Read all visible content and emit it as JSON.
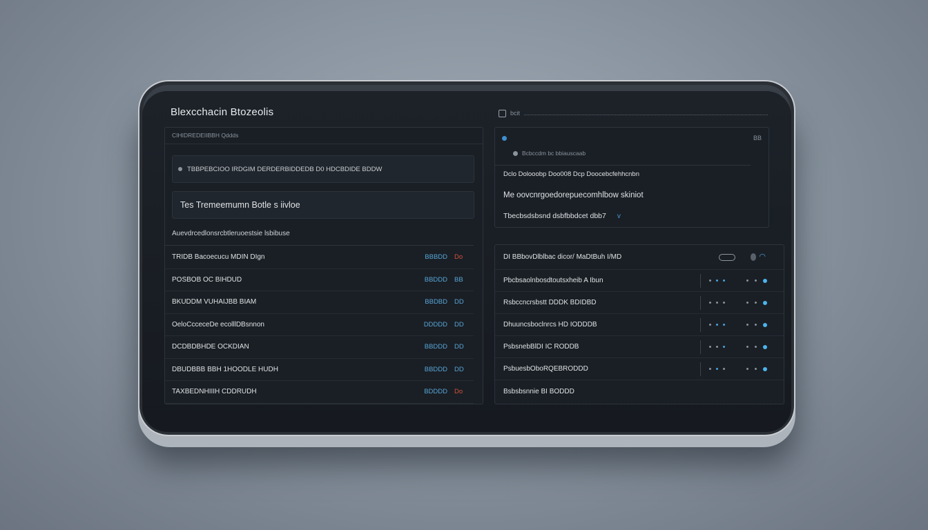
{
  "app": {
    "title": "Blexcchacin Btozeolis",
    "header_right_text": "bcit"
  },
  "left_panel": {
    "header_text": "CIHIDREDEIIBBH Qddds",
    "search_text": "TBBPEBCIOO IRDGIM DERDERBIDDEDB D0 HDCBDIDE BDDW",
    "input_value": "Tes  Tremeemumn Botle  s iivloe",
    "section_label": "Auevdrcedlonsrcbtleruoestsie lsbibuse",
    "transactions": [
      {
        "name": "TRIDB Bacoecucu MDIN DIgn",
        "amount": "BBBDD",
        "code": "Do",
        "code_color": "red"
      },
      {
        "name": "POSBOB OC BIHDUD",
        "amount": "BBDDD",
        "code": "BB",
        "code_color": "blue"
      },
      {
        "name": "BKUDDM VUHAIJBB BIAM",
        "amount": "BBDBD",
        "code": "DD",
        "code_color": "blue"
      },
      {
        "name": "OeloCcceceDe ecolllDBsnnon",
        "amount": "DDDDD",
        "code": "DD",
        "code_color": "blue"
      },
      {
        "name": "DCDBDBHDE OCKDIAN",
        "amount": "BBDDD",
        "code": "DD",
        "code_color": "blue"
      },
      {
        "name": "DBUDBBB BBH 1HOODLE HUDH",
        "amount": "BBDDD",
        "code": "DD",
        "code_color": "blue"
      },
      {
        "name": "TAXBEDNHIIIH CDDRUDH",
        "amount": "BDDDD",
        "code": "Do",
        "code_color": "red"
      }
    ]
  },
  "info_panel": {
    "badge": "BB",
    "subtitle": "Bcbccdm  bc  bbiauscaab",
    "line1": "Dclo Dolooobp Doo008 Dcp Doocebcfehhcnbn",
    "line2": "Me oovcnrgoedorepuecomhlbow skiniot",
    "line3": "Tbecbsdsbsnd dsbfbbdcet dbb7",
    "line3_icon": "v"
  },
  "node_panel": {
    "header_label": "DI BBbovDlblbac  dicor/ MaDtBuh I/MD",
    "rows": [
      "Pbcbsaolnbosdtoutsxheib A Ibun",
      "Rsbccncrsbstt DDDK BDIDBD",
      "Dhuuncsboclnrcs HD IODDDB",
      "PsbsnebBlDI IC RODDB",
      "PsbuesbOboRQEBRODDD",
      "Bsbsbsnnie BI BODDD"
    ]
  },
  "colors": {
    "accent_blue": "#57a6d8",
    "accent_red": "#d6503a",
    "screen_bg": "#161a20"
  },
  "icons": {
    "header_square": "square-icon",
    "search_dot": "dot-icon",
    "info_dot": "blue-dot-icon",
    "node_link": "link-icon",
    "node_toggle": "toggle-icon"
  }
}
